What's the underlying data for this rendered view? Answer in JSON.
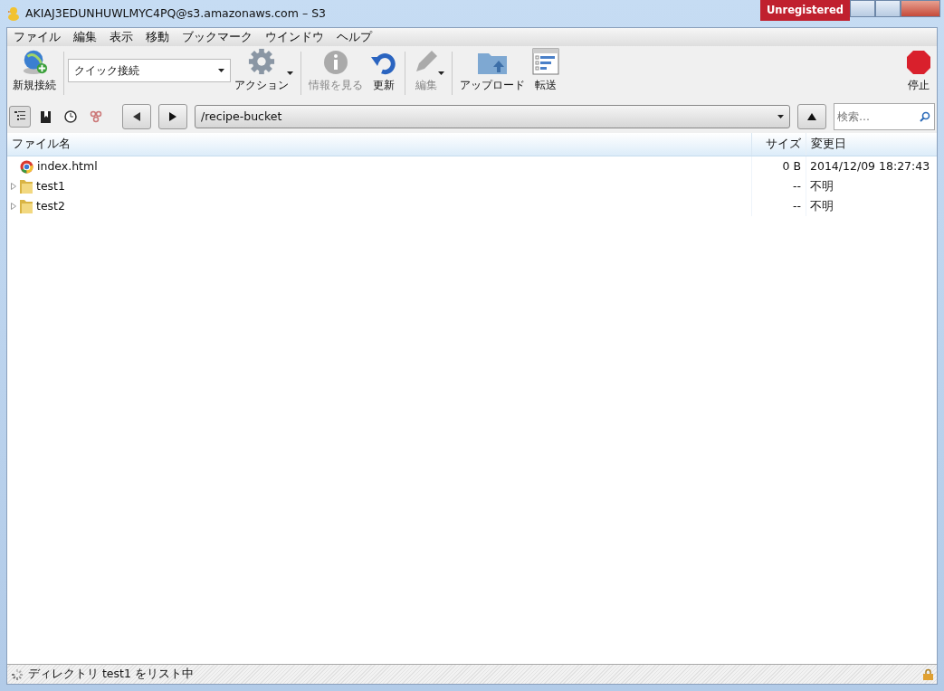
{
  "window": {
    "title": "AKIAJ3EDUNHUWLMYC4PQ@s3.amazonaws.com – S3",
    "badge": "Unregistered"
  },
  "menu": [
    "ファイル",
    "編集",
    "表示",
    "移動",
    "ブックマーク",
    "ウインドウ",
    "ヘルプ"
  ],
  "toolbar": [
    {
      "kind": "new-connection",
      "label": "新規接続",
      "disabled": false
    },
    {
      "kind": "quick-connect",
      "value": "クイック接続"
    },
    {
      "kind": "action",
      "label": "アクション",
      "disabled": false
    },
    {
      "kind": "info",
      "label": "情報を見る",
      "disabled": true
    },
    {
      "kind": "refresh",
      "label": "更新",
      "disabled": false
    },
    {
      "kind": "edit",
      "label": "編集",
      "disabled": true
    },
    {
      "kind": "upload",
      "label": "アップロード",
      "disabled": false
    },
    {
      "kind": "transfers",
      "label": "転送",
      "disabled": false
    },
    {
      "kind": "stop",
      "label": "停止",
      "disabled": false
    }
  ],
  "view_toggles": [
    {
      "kind": "browser",
      "selected": true
    },
    {
      "kind": "bookmarks",
      "selected": false
    },
    {
      "kind": "history",
      "selected": false
    },
    {
      "kind": "bonjour",
      "selected": false
    }
  ],
  "path": "/recipe-bucket",
  "search": {
    "placeholder": "検索…"
  },
  "table": {
    "columns": [
      "ファイル名",
      "サイズ",
      "変更日"
    ],
    "rows": [
      {
        "kind": "file",
        "name": "index.html",
        "size": "0 B",
        "modified": "2014/12/09 18:27:43"
      },
      {
        "kind": "folder",
        "name": "test1",
        "size": "--",
        "modified": "不明"
      },
      {
        "kind": "folder",
        "name": "test2",
        "size": "--",
        "modified": "不明"
      }
    ]
  },
  "status_bar": "ディレクトリ test1 をリスト中"
}
